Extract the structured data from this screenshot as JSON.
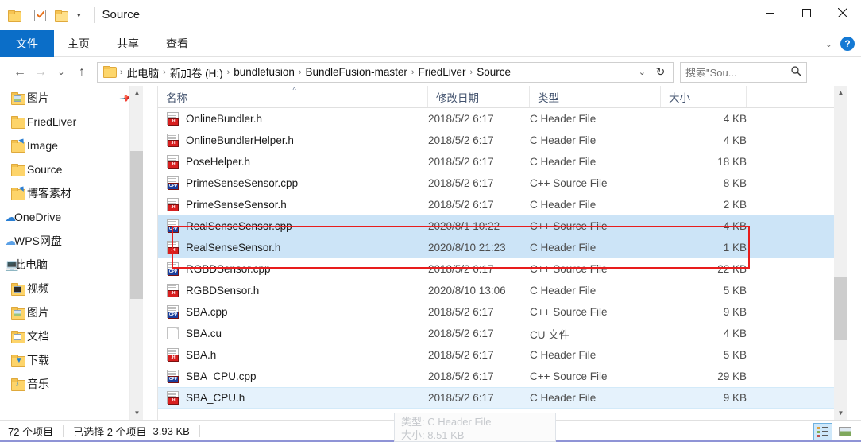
{
  "window": {
    "title": "Source",
    "minimize_label": "最小化",
    "maximize_label": "最大化",
    "close_label": "关闭"
  },
  "quick_access": {
    "folder_icon": "folder-icon",
    "properties_icon": "checkbox-icon",
    "new_folder_icon": "new-folder-icon",
    "customize_caret": "▾"
  },
  "ribbon": {
    "tabs": [
      {
        "label": "文件",
        "active": true
      },
      {
        "label": "主页",
        "active": false
      },
      {
        "label": "共享",
        "active": false
      },
      {
        "label": "查看",
        "active": false
      }
    ],
    "collapse_caret": "⌄",
    "help_label": "?"
  },
  "address": {
    "back_icon": "←",
    "forward_icon": "→",
    "history_icon": "⌄",
    "up_icon": "↑",
    "breadcrumb": [
      "此电脑",
      "新加卷 (H:)",
      "bundlefusion",
      "BundleFusion-master",
      "FriedLiver",
      "Source"
    ],
    "separator": "›",
    "dropdown_caret": "⌄",
    "refresh_icon": "↻"
  },
  "search": {
    "placeholder": "搜索\"Sou...",
    "icon": "search-icon"
  },
  "sidebar": {
    "items": [
      {
        "label": "图片",
        "icon": "folder-pictures-icon",
        "level": 1,
        "pinned": true
      },
      {
        "label": "FriedLiver",
        "icon": "folder-icon",
        "level": 1,
        "pinned": false
      },
      {
        "label": "Image",
        "icon": "folder-shortcut-icon",
        "level": 1,
        "pinned": false
      },
      {
        "label": "Source",
        "icon": "folder-icon",
        "level": 1,
        "pinned": false
      },
      {
        "label": "博客素材",
        "icon": "folder-shortcut-icon",
        "level": 1,
        "pinned": false
      },
      {
        "label": "OneDrive",
        "icon": "onedrive-cloud-icon",
        "level": 0,
        "pinned": false
      },
      {
        "label": "WPS网盘",
        "icon": "wps-cloud-icon",
        "level": 0,
        "pinned": false
      },
      {
        "label": "此电脑",
        "icon": "this-pc-icon",
        "level": 0,
        "pinned": false
      },
      {
        "label": "视频",
        "icon": "folder-videos-icon",
        "level": 1,
        "pinned": false
      },
      {
        "label": "图片",
        "icon": "folder-pictures-icon",
        "level": 1,
        "pinned": false
      },
      {
        "label": "文档",
        "icon": "folder-documents-icon",
        "level": 1,
        "pinned": false
      },
      {
        "label": "下载",
        "icon": "folder-downloads-icon",
        "level": 1,
        "pinned": false
      },
      {
        "label": "音乐",
        "icon": "folder-music-icon",
        "level": 1,
        "pinned": false
      }
    ]
  },
  "filelist": {
    "columns": [
      {
        "label": "名称",
        "sorted": true,
        "sort_indicator": "^"
      },
      {
        "label": "修改日期",
        "sorted": false,
        "sort_indicator": ""
      },
      {
        "label": "类型",
        "sorted": false,
        "sort_indicator": ""
      },
      {
        "label": "大小",
        "sorted": false,
        "sort_indicator": ""
      }
    ],
    "rows": [
      {
        "name": "OnlineBundler.h",
        "date": "2018/5/2 6:17",
        "type": "C Header File",
        "size": "4 KB",
        "icon": "h-file-icon",
        "state": ""
      },
      {
        "name": "OnlineBundlerHelper.h",
        "date": "2018/5/2 6:17",
        "type": "C Header File",
        "size": "4 KB",
        "icon": "h-file-icon",
        "state": ""
      },
      {
        "name": "PoseHelper.h",
        "date": "2018/5/2 6:17",
        "type": "C Header File",
        "size": "18 KB",
        "icon": "h-file-icon",
        "state": ""
      },
      {
        "name": "PrimeSenseSensor.cpp",
        "date": "2018/5/2 6:17",
        "type": "C++ Source File",
        "size": "8 KB",
        "icon": "cpp-file-icon",
        "state": ""
      },
      {
        "name": "PrimeSenseSensor.h",
        "date": "2018/5/2 6:17",
        "type": "C Header File",
        "size": "2 KB",
        "icon": "h-file-icon",
        "state": ""
      },
      {
        "name": "RealSenseSensor.cpp",
        "date": "2020/8/1 10:22",
        "type": "C++ Source File",
        "size": "4 KB",
        "icon": "cpp-file-icon",
        "state": "selected"
      },
      {
        "name": "RealSenseSensor.h",
        "date": "2020/8/10 21:23",
        "type": "C Header File",
        "size": "1 KB",
        "icon": "h-file-icon",
        "state": "selected"
      },
      {
        "name": "RGBDSensor.cpp",
        "date": "2018/5/2 6:17",
        "type": "C++ Source File",
        "size": "22 KB",
        "icon": "cpp-file-icon",
        "state": ""
      },
      {
        "name": "RGBDSensor.h",
        "date": "2020/8/10 13:06",
        "type": "C Header File",
        "size": "5 KB",
        "icon": "h-file-icon",
        "state": ""
      },
      {
        "name": "SBA.cpp",
        "date": "2018/5/2 6:17",
        "type": "C++ Source File",
        "size": "9 KB",
        "icon": "cpp-file-icon",
        "state": ""
      },
      {
        "name": "SBA.cu",
        "date": "2018/5/2 6:17",
        "type": "CU 文件",
        "size": "4 KB",
        "icon": "generic-file-icon",
        "state": ""
      },
      {
        "name": "SBA.h",
        "date": "2018/5/2 6:17",
        "type": "C Header File",
        "size": "5 KB",
        "icon": "h-file-icon",
        "state": ""
      },
      {
        "name": "SBA_CPU.cpp",
        "date": "2018/5/2 6:17",
        "type": "C++ Source File",
        "size": "29 KB",
        "icon": "cpp-file-icon",
        "state": ""
      },
      {
        "name": "SBA_CPU.h",
        "date": "2018/5/2 6:17",
        "type": "C Header File",
        "size": "9 KB",
        "icon": "h-file-icon",
        "state": "hover"
      }
    ]
  },
  "tooltip": {
    "type_line": "类型: C Header File",
    "size_line": "大小: 8.51 KB"
  },
  "statusbar": {
    "item_count": "72 个项目",
    "selection": "已选择 2 个项目",
    "selection_size": "3.93 KB",
    "details_view_label": "详细信息",
    "thumbnail_view_label": "大图标"
  },
  "annotation": {
    "color": "#e81d1d",
    "note": "red-highlight-rectangle"
  }
}
